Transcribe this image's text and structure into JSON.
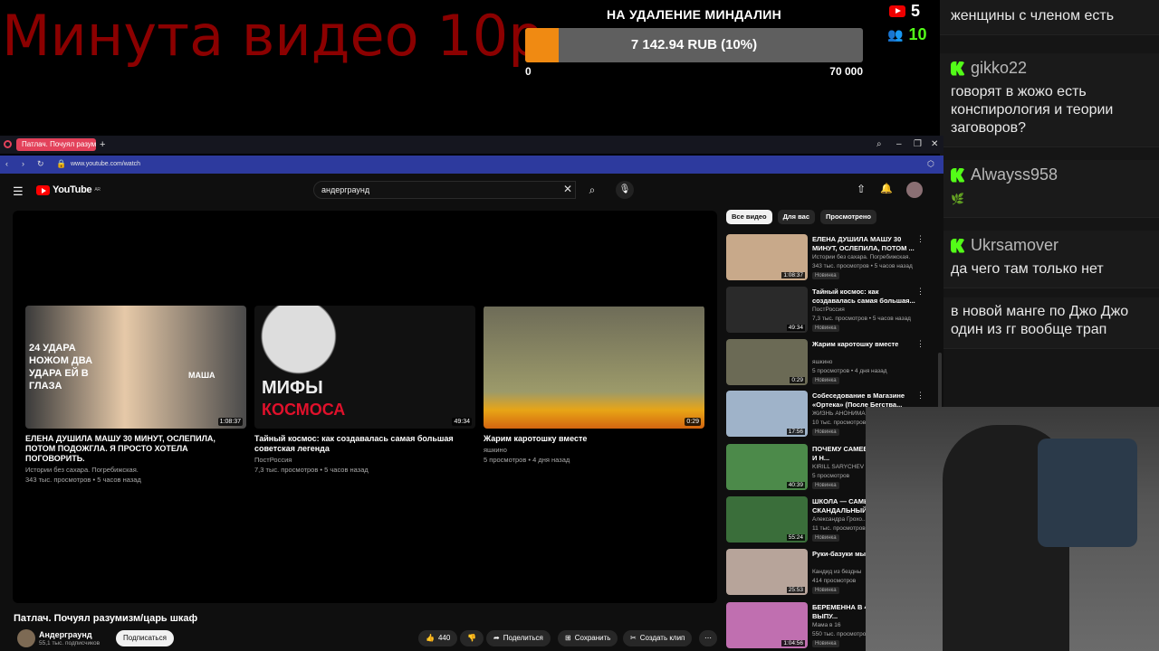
{
  "overlay": {
    "banner_text": "Минута видео 10р",
    "goal": {
      "title": "НА УДАЛЕНИЕ МИНДАЛИН",
      "amount_text": "7 142.94 RUB (10%)",
      "progress_fraction": 0.1,
      "min_label": "0",
      "max_label": "70 000",
      "fill_color": "#f08a12"
    },
    "youtube_viewers": "5",
    "kick_viewers": "10"
  },
  "chat": [
    {
      "user": "",
      "text": "женщины с членом есть"
    },
    {
      "user": "gikko22",
      "text": "говорят в жожо есть конспирология и теории заговоров?"
    },
    {
      "user": "Alwayss958",
      "text": "🌿"
    },
    {
      "user": "Ukrsamover",
      "text": "да чего там только нет"
    },
    {
      "user": "",
      "text": "в новой манге по Джо Джо один из гг вообще трап"
    }
  ],
  "browser": {
    "tab_title": "Патлач. Почуял разумизм",
    "url": "www.youtube.com/watch"
  },
  "youtube": {
    "logo_text": "YouTube",
    "logo_region": "AR",
    "search_query": "андерграунд",
    "end_cards": [
      {
        "title": "ЕЛЕНА ДУШИЛА МАШУ 30 МИНУТ, ОСЛЕПИЛА, ПОТОМ ПОДОЖГЛА. Я ПРОСТО ХОТЕЛА ПОГОВОРИТЬ.",
        "channel": "Истории без сахара. Погребижская.",
        "meta": "343 тыс. просмотров • 5 часов назад",
        "duration": "1:08:37",
        "thumb_text_1": "24 УДАРА НОЖОМ ДВА УДАРА ЕЙ В ГЛАЗА",
        "thumb_text_2": "МАША"
      },
      {
        "title": "Тайный космос: как создавалась самая большая советская легенда",
        "channel": "ПостРоссия",
        "meta": "7,3 тыс. просмотров • 5 часов назад",
        "duration": "49:34",
        "thumb_text_1": "МИФЫ",
        "thumb_text_2": "КОСМОСА"
      },
      {
        "title": "Жарим каротошку вместе",
        "channel": "яшкино",
        "meta": "5 просмотров • 4 дня назад",
        "duration": "0:29"
      }
    ],
    "video_title": "Патлач. Почуял разумизм/царь шкаф",
    "channel_name": "Андерграунд",
    "channel_subs": "55,1 тыс. подписчиков",
    "subscribe_label": "Подписаться",
    "likes": "440",
    "share_label": "Поделиться",
    "save_label": "Сохранить",
    "clip_label": "Создать клип",
    "chips": [
      "Все видео",
      "Для вас",
      "Просмотрено"
    ],
    "recommendations": [
      {
        "title": "ЕЛЕНА ДУШИЛА МАШУ 30 МИНУТ, ОСЛЕПИЛА, ПОТОМ ...",
        "channel": "Истории без сахара. Погребижская.",
        "meta": "343 тыс. просмотров • 5 часов назад",
        "duration": "1:08:37",
        "badge": "Новинка",
        "color": "#c8a98a"
      },
      {
        "title": "Тайный космос: как создавалась самая большая...",
        "channel": "ПостРоссия",
        "meta": "7,3 тыс. просмотров • 5 часов назад",
        "duration": "49:34",
        "badge": "Новинка",
        "color": "#2a2a2a"
      },
      {
        "title": "Жарим каротошку вместе",
        "channel": "яшкино",
        "meta": "5 просмотров • 4 дня назад",
        "duration": "0:29",
        "badge": "Новинка",
        "color": "#6b6a55"
      },
      {
        "title": "Собеседование в Магазине «Ортека» (После Бегства...",
        "channel": "ЖИЗНЬ АНОНИМА",
        "meta": "10 тыс. просмотров",
        "duration": "17:56",
        "badge": "Новинка",
        "color": "#9fb3c9"
      },
      {
        "title": "ПОЧЕМУ САМЕЕВ ВЫСТУПАЕТ И Н...",
        "channel": "KIRILL SARYCHEV",
        "meta": "5 просмотров",
        "duration": "40:39",
        "badge": "Новинка",
        "color": "#4c8a4a"
      },
      {
        "title": "ШКОЛА — САМЫЙ СКАНДАЛЬНЫЙ...",
        "channel": "Александра Грохо...",
        "meta": "11 тыс. просмотров",
        "duration": "55:24",
        "badge": "Новинка",
        "color": "#3a6e3a"
      },
      {
        "title": "Руки-базуки мы алкоголик?😊",
        "channel": "Кандид из бездны",
        "meta": "414 просмотров",
        "duration": "25:53",
        "badge": "Новинка",
        "color": "#b7a49a"
      },
      {
        "title": "БЕРЕМЕННА В 4... СЕЗОН | 3 ВЫПУ...",
        "channel": "Мама в 16",
        "meta": "550 тыс. просмотров",
        "duration": "1:04:56",
        "badge": "Новинка",
        "color": "#c06fb0"
      }
    ]
  }
}
